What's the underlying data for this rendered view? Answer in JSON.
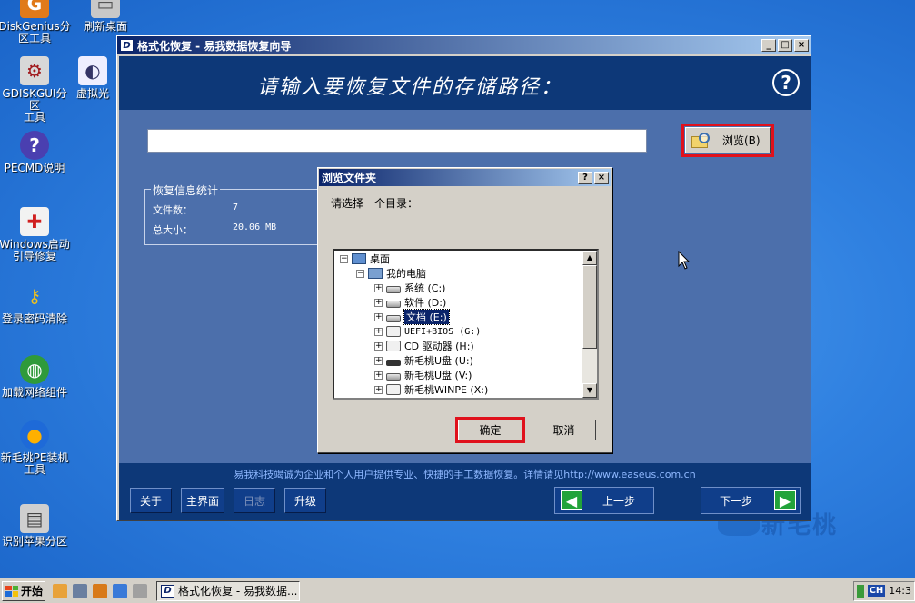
{
  "desktop": {
    "icons": [
      {
        "label": "DiskGenius分\n区工具",
        "icon": "diskgenius-icon"
      },
      {
        "label": "刷新桌面",
        "icon": "refresh-desktop-icon"
      },
      {
        "label": "GDISKGUI分区\n工具",
        "icon": "gdisk-icon"
      },
      {
        "label": "虚拟光",
        "icon": "virtual-cd-icon"
      },
      {
        "label": "PECMD说明",
        "icon": "help-icon"
      },
      {
        "label": "Windows启动\n引导修复",
        "icon": "boot-repair-icon"
      },
      {
        "label": "登录密码清除",
        "icon": "key-icon"
      },
      {
        "label": "加载网络组件",
        "icon": "network-icon"
      },
      {
        "label": "新毛桃PE装机\n工具",
        "icon": "peach-icon"
      },
      {
        "label": "识别苹果分区",
        "icon": "apple-partition-icon"
      }
    ],
    "watermark": "新毛桃"
  },
  "main_window": {
    "title": "格式化恢复 - 易我数据恢复向导",
    "app_icon": "D",
    "header_title": "请输入要恢复文件的存储路径：",
    "help_glyph": "?",
    "path_value": "",
    "browse_label": "浏览(B)",
    "stats": {
      "legend": "恢复信息统计",
      "file_count_label": "文件数：",
      "file_count_value": "7",
      "total_size_label": "总大小：",
      "total_size_value": "20.06 MB"
    },
    "footer_notice": "易我科技竭诚为企业和个人用户提供专业、快捷的手工数据恢复。详情请见http://www.easeus.com.cn",
    "buttons": {
      "about": "关于",
      "home": "主界面",
      "log": "日志",
      "upgrade": "升级",
      "prev": "上一步",
      "next": "下一步"
    }
  },
  "dialog": {
    "title": "浏览文件夹",
    "help_btn": "?",
    "close_btn": "×",
    "prompt": "请选择一个目录：",
    "tree": [
      {
        "label": "桌面",
        "icon": "desktop",
        "expander": "−",
        "indent": 0
      },
      {
        "label": "我的电脑",
        "icon": "pc",
        "expander": "−",
        "indent": 1
      },
      {
        "label": "系统 (C:)",
        "icon": "drive",
        "expander": "+",
        "indent": 2
      },
      {
        "label": "软件 (D:)",
        "icon": "drive",
        "expander": "+",
        "indent": 2
      },
      {
        "label": "文档 (E:)",
        "icon": "drive",
        "expander": "+",
        "indent": 2,
        "selected": true
      },
      {
        "label": "UEFI+BIOS (G:)",
        "icon": "cd",
        "expander": "+",
        "indent": 2
      },
      {
        "label": "CD 驱动器 (H:)",
        "icon": "cd",
        "expander": "+",
        "indent": 2
      },
      {
        "label": "新毛桃U盘 (U:)",
        "icon": "usb",
        "expander": "+",
        "indent": 2
      },
      {
        "label": "新毛桃U盘 (V:)",
        "icon": "drive",
        "expander": "+",
        "indent": 2
      },
      {
        "label": "新毛桃WINPE (X:)",
        "icon": "cd",
        "expander": "+",
        "indent": 2
      }
    ],
    "ok_label": "确定",
    "cancel_label": "取消"
  },
  "taskbar": {
    "start_label": "开始",
    "task_title": "格式化恢复 - 易我数据...",
    "lang": "CH",
    "clock": "14:3"
  },
  "colors": {
    "navy": "#0d3878",
    "content_blue": "#4c6fab",
    "highlight_red": "#e0111c",
    "selection": "#0a246a"
  }
}
